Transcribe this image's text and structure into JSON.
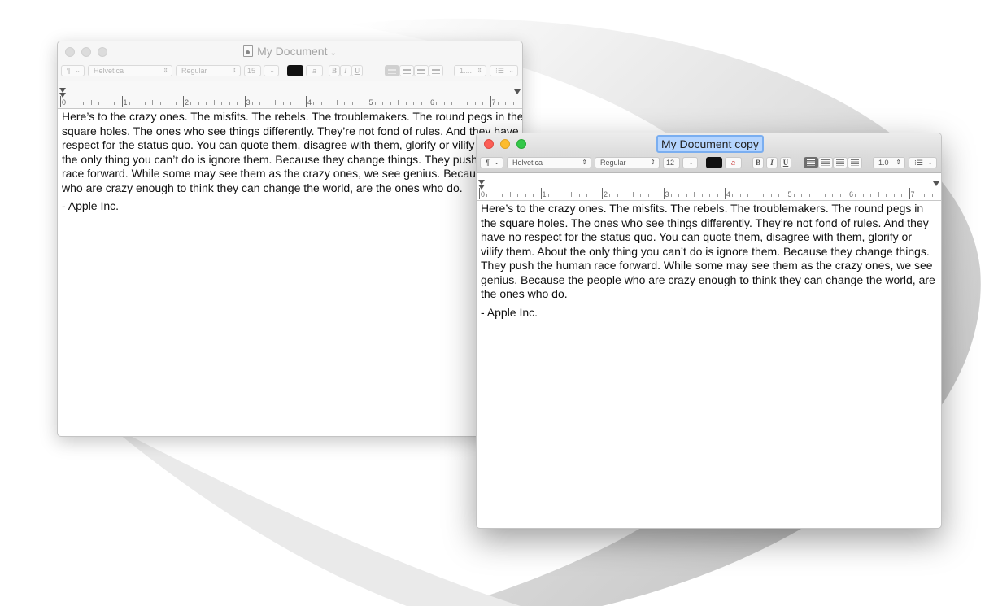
{
  "colors": {
    "close": "#fc5f57",
    "minimize": "#fdbc2e",
    "zoom": "#34c84a",
    "selection": "#b5d5ff"
  },
  "back_window": {
    "title": "My Document",
    "toolbar": {
      "paragraph_style": "¶",
      "font": "Helvetica",
      "typeface": "Regular",
      "size": "15",
      "line_spacing": "1....",
      "bold": "B",
      "italic": "I",
      "underline": "U"
    },
    "ruler_numbers": [
      "0",
      "1",
      "2",
      "3",
      "4",
      "5",
      "6",
      "7"
    ],
    "body": [
      "Here’s to the crazy ones. The misfits. The rebels. The troublemakers. The round pegs in the square holes. The ones who see things differently. They’re not fond of rules. And they have no respect for the status quo. You can quote them, disagree with them, glorify or vilify them. About the only thing you can’t do is ignore them. Because they change things. They push the human race forward. While some may see them as the crazy ones, we see genius. Because the people who are crazy enough to think they can change the world, are the ones who do.",
      "- Apple Inc."
    ]
  },
  "front_window": {
    "title": "My Document copy",
    "toolbar": {
      "paragraph_style": "¶",
      "font": "Helvetica",
      "typeface": "Regular",
      "size": "12",
      "line_spacing": "1.0",
      "bold": "B",
      "italic": "I",
      "underline": "U"
    },
    "ruler_numbers": [
      "0",
      "1",
      "2",
      "3",
      "4",
      "5",
      "6",
      "7"
    ],
    "body": [
      "Here’s to the crazy ones. The misfits. The rebels. The troublemakers. The round pegs in the square holes. The ones who see things differently. They’re not fond of rules. And they have no respect for the status quo. You can quote them, disagree with them, glorify or vilify them. About the only thing you can’t do is ignore them. Because they change things. They push the human race forward. While some may see them as the crazy ones, we see genius. Because the people who are crazy enough to think they can change the world, are the ones who do.",
      "- Apple Inc."
    ]
  }
}
